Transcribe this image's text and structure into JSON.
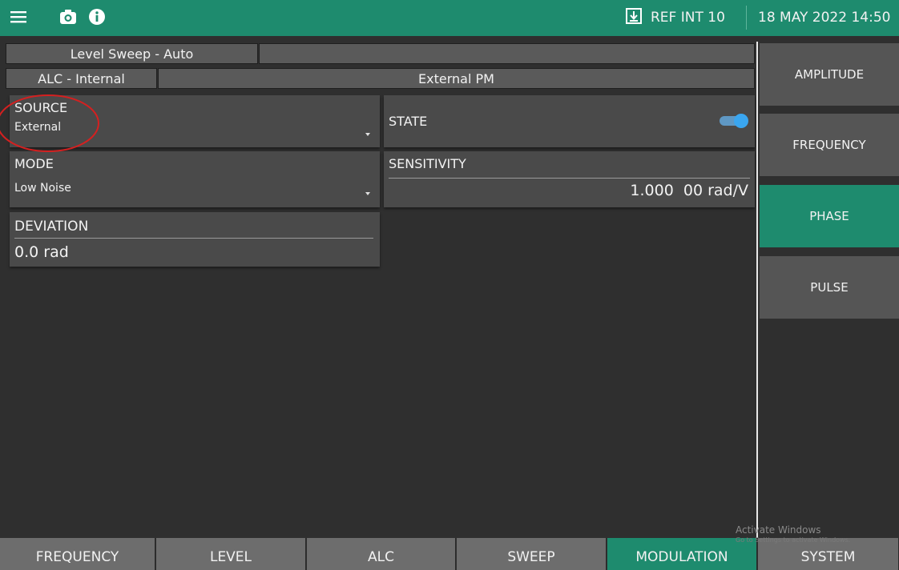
{
  "header": {
    "icons": [
      "menu-icon",
      "camera-icon",
      "info-icon",
      "download-icon"
    ],
    "ref": "REF INT 10",
    "datetime": "18 MAY 2022 14:50"
  },
  "status": {
    "sweep": "Level Sweep - Auto",
    "alc": "ALC - Internal",
    "mode": "External PM"
  },
  "panels": {
    "source": {
      "title": "SOURCE",
      "value": "External"
    },
    "state": {
      "title": "STATE",
      "on": true
    },
    "mode": {
      "title": "MODE",
      "value": "Low Noise"
    },
    "sensitivity": {
      "title": "SENSITIVITY",
      "value": "1.000  00 rad/V"
    },
    "deviation": {
      "title": "DEVIATION",
      "value": "0.0 rad"
    }
  },
  "side_menu": [
    {
      "label": "AMPLITUDE",
      "active": false
    },
    {
      "label": "FREQUENCY",
      "active": false
    },
    {
      "label": "PHASE",
      "active": true
    },
    {
      "label": "PULSE",
      "active": false
    }
  ],
  "tabs": [
    {
      "label": "FREQUENCY",
      "active": false
    },
    {
      "label": "LEVEL",
      "active": false
    },
    {
      "label": "ALC",
      "active": false
    },
    {
      "label": "SWEEP",
      "active": false
    },
    {
      "label": "MODULATION",
      "active": true
    },
    {
      "label": "SYSTEM",
      "active": false
    }
  ],
  "watermark": {
    "line1": "Activate Windows",
    "line2": "Go to Settings to activate Windows."
  },
  "colors": {
    "accent": "#1e8b6e",
    "toggle": "#3aa6f0",
    "highlight_circle": "#d42020"
  }
}
